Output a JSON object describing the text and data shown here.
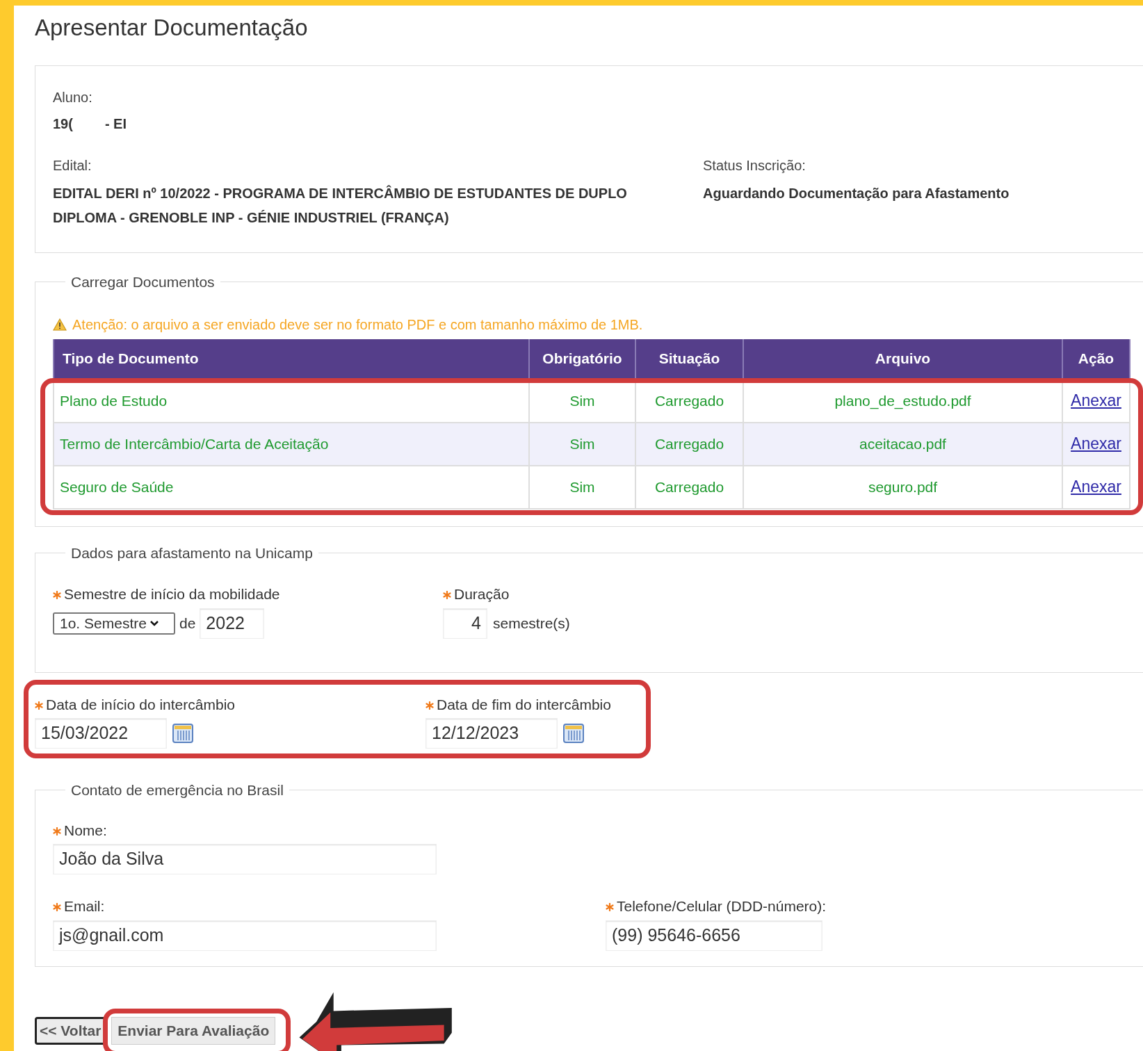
{
  "title": "Apresentar Documentação",
  "info": {
    "aluno": {
      "label": "Aluno:",
      "parts": [
        "19(",
        "- EI"
      ]
    },
    "edital": {
      "label": "Edital:",
      "value": "EDITAL DERI nº 10/2022 - PROGRAMA DE INTERCÂMBIO DE ESTUDANTES DE DUPLO DIPLOMA - GRENOBLE INP - GÉNIE INDUSTRIEL (FRANÇA)"
    },
    "status": {
      "label": "Status Inscrição:",
      "value": "Aguardando Documentação para Afastamento"
    }
  },
  "documents": {
    "legend": "Carregar Documentos",
    "warning": "Atenção: o arquivo a ser enviado deve ser no formato PDF e com tamanho máximo de 1MB.",
    "highlighted": true,
    "columns": [
      "Tipo de Documento",
      "Obrigatório",
      "Situação",
      "Arquivo",
      "Ação"
    ],
    "rows": [
      {
        "tipo": "Plano de Estudo",
        "obrigatorio": "Sim",
        "situacao": "Carregado",
        "arquivo": "plano_de_estudo.pdf",
        "acao": "Anexar"
      },
      {
        "tipo": "Termo de Intercâmbio/Carta de Aceitação",
        "obrigatorio": "Sim",
        "situacao": "Carregado",
        "arquivo": "aceitacao.pdf",
        "acao": "Anexar"
      },
      {
        "tipo": "Seguro de Saúde",
        "obrigatorio": "Sim",
        "situacao": "Carregado",
        "arquivo": "seguro.pdf",
        "acao": "Anexar"
      }
    ]
  },
  "afastamento": {
    "legend": "Dados para afastamento na Unicamp",
    "semestre": {
      "label": "Semestre de início da mobilidade",
      "required": true,
      "value": "1o. Semestre",
      "de": "de",
      "year": "2022"
    },
    "duracao": {
      "label": "Duração",
      "required": true,
      "value": "4",
      "unit": "semestre(s)"
    }
  },
  "datas": {
    "highlighted": true,
    "fields": [
      {
        "label": "Data de início do intercâmbio",
        "required": true,
        "value": "15/03/2022"
      },
      {
        "label": "Data de fim do intercâmbio",
        "required": true,
        "value": "12/12/2023"
      }
    ]
  },
  "contato": {
    "legend": "Contato de emergência no Brasil",
    "nome": {
      "label": "Nome:",
      "required": true,
      "value": "João da Silva"
    },
    "email": {
      "label": "Email:",
      "required": true,
      "value": "js@gnail.com"
    },
    "telefone": {
      "label": "Telefone/Celular (DDD-número):",
      "required": true,
      "value": "(99) 95646-6656"
    }
  },
  "buttons": [
    {
      "label": "<< Voltar",
      "kind": "back",
      "highlighted": false
    },
    {
      "label": "Enviar Para Avaliação",
      "kind": "submit",
      "highlighted": true
    }
  ]
}
